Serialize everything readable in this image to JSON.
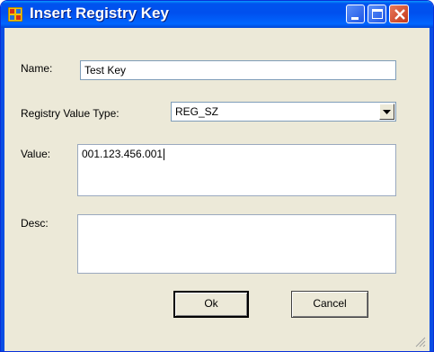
{
  "window": {
    "title": "Insert Registry Key"
  },
  "form": {
    "name_label": "Name:",
    "name_value": "Test Key",
    "type_label": "Registry Value Type:",
    "type_value": "REG_SZ",
    "value_label": "Value:",
    "value_value": "001.123.456.001",
    "desc_label": "Desc:",
    "desc_value": ""
  },
  "buttons": {
    "ok": "Ok",
    "cancel": "Cancel"
  },
  "colors": {
    "titlebar": "#0053ee",
    "face": "#ece9d8",
    "close": "#c3381b"
  },
  "icons": {
    "app": "registry-icon",
    "minimize": "minimize-icon",
    "maximize": "maximize-icon",
    "close": "close-icon",
    "dropdown": "chevron-down-icon",
    "resize": "resize-grip-icon"
  }
}
